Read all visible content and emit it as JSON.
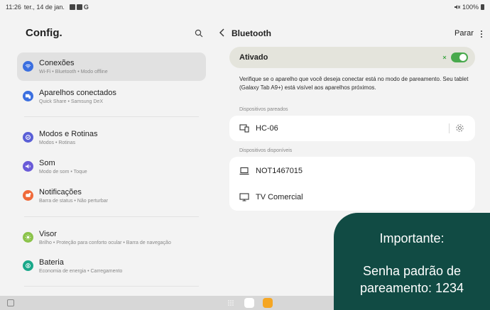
{
  "status_bar": {
    "time": "11:26",
    "date": "ter., 14 de jan.",
    "battery": "100%"
  },
  "settings": {
    "title": "Config.",
    "items": [
      {
        "title": "Conexões",
        "subtitle": "Wi-Fi • Bluetooth • Modo offline",
        "icon": "wifi-icon",
        "color": "#3b6fe0"
      },
      {
        "title": "Aparelhos conectados",
        "subtitle": "Quick Share • Samsung DeX",
        "icon": "devices-icon",
        "color": "#3b6fe0"
      },
      {
        "title": "Modos e Rotinas",
        "subtitle": "Modos • Rotinas",
        "icon": "modes-icon",
        "color": "#5a5fd6"
      },
      {
        "title": "Som",
        "subtitle": "Modo de som • Toque",
        "icon": "volume-icon",
        "color": "#6a5bd8"
      },
      {
        "title": "Notificações",
        "subtitle": "Barra de status • Não perturbar",
        "icon": "notification-icon",
        "color": "#f06a3a"
      },
      {
        "title": "Visor",
        "subtitle": "Brilho • Proteção para conforto ocular • Barra de navegação",
        "icon": "sun-icon",
        "color": "#8bc34a"
      },
      {
        "title": "Bateria",
        "subtitle": "Economia de energia • Carregamento",
        "icon": "battery-icon",
        "color": "#19a88a"
      }
    ]
  },
  "bluetooth": {
    "title": "Bluetooth",
    "stop_label": "Parar",
    "status_label": "Ativado",
    "toggle_on": true,
    "description": "Verifique se o aparelho que você deseja conectar está no modo de pareamento. Seu tablet (Galaxy Tab A9+) está visível aos aparelhos próximos.",
    "paired_header": "Dispositivos pareados",
    "paired": [
      {
        "name": "HC-06",
        "icon": "devices-icon"
      }
    ],
    "available_header": "Dispositivos disponíveis",
    "available": [
      {
        "name": "NOT1467015",
        "icon": "laptop-icon"
      },
      {
        "name": "TV Comercial",
        "icon": "monitor-icon"
      }
    ]
  },
  "callout": {
    "heading": "Importante:",
    "body": "Senha padrão de pareamento: 1234"
  },
  "colors": {
    "accent_green": "#48a94c",
    "callout_bg": "#114b44"
  }
}
